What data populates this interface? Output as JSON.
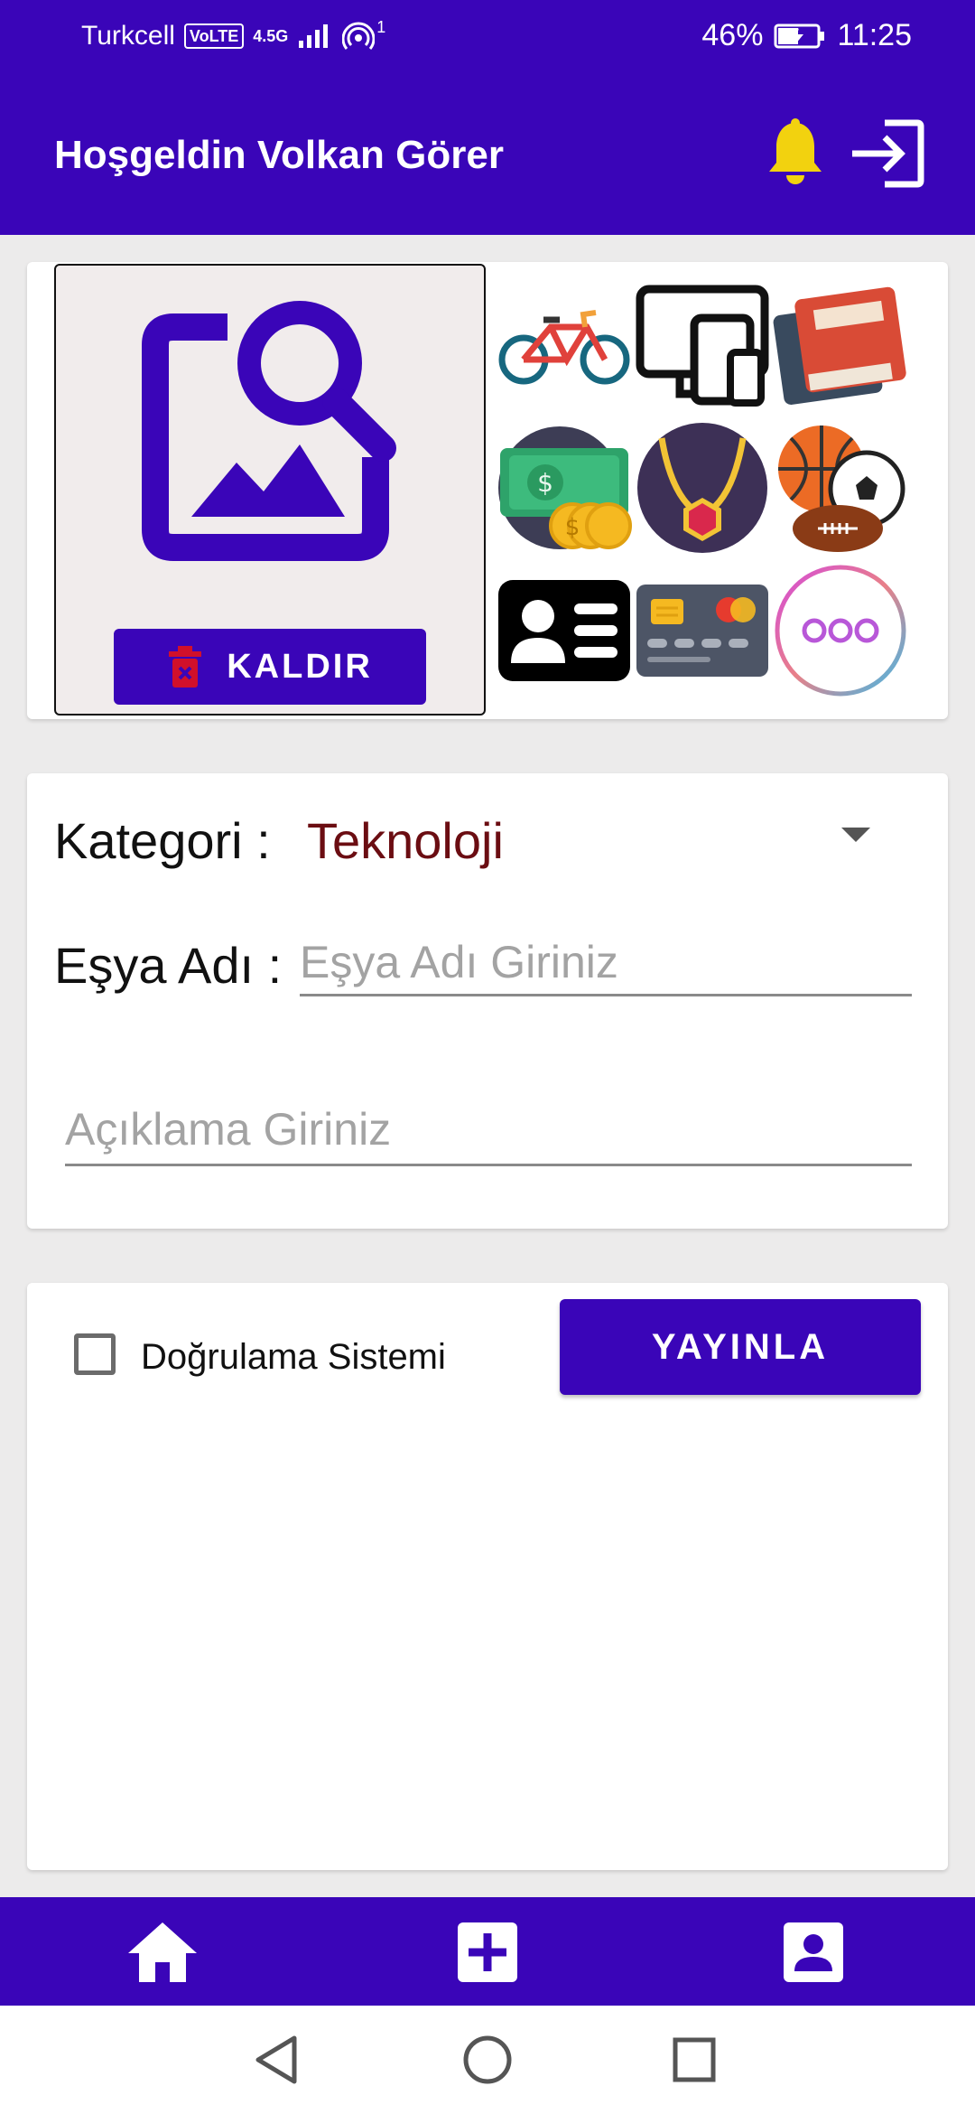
{
  "status_bar": {
    "carrier": "Turkcell",
    "volte": "VoLTE",
    "network": "4.5G",
    "hotspot_count": "1",
    "battery_percent": "46%",
    "time": "11:25"
  },
  "app_bar": {
    "title": "Hoşgeldin Volkan Görer",
    "bell_icon": "notification-bell",
    "logout_icon": "logout-arrow"
  },
  "image_picker": {
    "icon": "image-search",
    "remove_label": "KALDIR",
    "remove_icon": "trash"
  },
  "categories": [
    {
      "icon": "bicycle"
    },
    {
      "icon": "devices"
    },
    {
      "icon": "books"
    },
    {
      "icon": "money"
    },
    {
      "icon": "jewelry"
    },
    {
      "icon": "sports-balls"
    },
    {
      "icon": "id-card"
    },
    {
      "icon": "credit-card"
    },
    {
      "icon": "more"
    }
  ],
  "form": {
    "category_label": "Kategori :",
    "category_value": "Teknoloji",
    "item_name_label": "Eşya Adı :",
    "item_name_placeholder": "Eşya Adı Giriniz",
    "item_name_value": "",
    "description_placeholder": "Açıklama Giriniz",
    "description_value": ""
  },
  "publish": {
    "verification_label": "Doğrulama Sistemi",
    "verification_checked": false,
    "button_label": "YAYINLA"
  },
  "bottom_nav": [
    {
      "icon": "home"
    },
    {
      "icon": "add-box"
    },
    {
      "icon": "account-box"
    }
  ],
  "colors": {
    "primary": "#3a05b8",
    "bell": "#f2d20f",
    "category_value": "#6b0d12",
    "trash": "#d1102b"
  }
}
